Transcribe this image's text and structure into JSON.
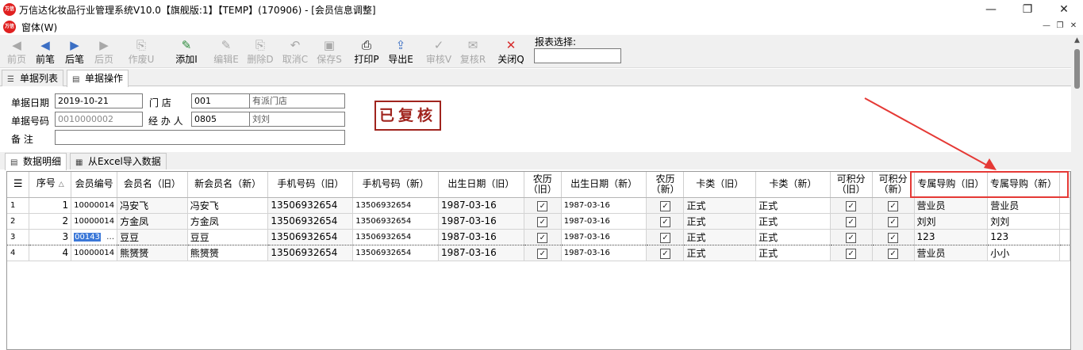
{
  "window": {
    "title": "万信达化妆品行业管理系统V10.0【旗舰版:1】【TEMP】(170906) - [会员信息调整]",
    "logo_text": "万信"
  },
  "menubar": {
    "menu_label": "窗体(W)"
  },
  "toolbar": {
    "buttons": [
      {
        "label": "前页",
        "icon": "◀",
        "enabled": false
      },
      {
        "label": "前笔",
        "icon": "◀",
        "enabled": true
      },
      {
        "label": "后笔",
        "icon": "▶",
        "enabled": true
      },
      {
        "label": "后页",
        "icon": "▶",
        "enabled": false
      },
      {
        "label": "作废U",
        "icon": "⎘",
        "enabled": false
      },
      {
        "label": "添加I",
        "icon": "✎",
        "enabled": true
      },
      {
        "label": "编辑E",
        "icon": "✎",
        "enabled": false
      },
      {
        "label": "删除D",
        "icon": "⎘",
        "enabled": false
      },
      {
        "label": "取消C",
        "icon": "↶",
        "enabled": false
      },
      {
        "label": "保存S",
        "icon": "▣",
        "enabled": false
      },
      {
        "label": "打印P",
        "icon": "⎙",
        "enabled": true
      },
      {
        "label": "导出E",
        "icon": "⇪",
        "enabled": true
      },
      {
        "label": "审核V",
        "icon": "✓",
        "enabled": false
      },
      {
        "label": "复核R",
        "icon": "✉",
        "enabled": false
      },
      {
        "label": "关闭Q",
        "icon": "✕",
        "enabled": true
      }
    ],
    "report_label": "报表选择:",
    "report_value": ""
  },
  "tabs_top": [
    {
      "label": "单据列表",
      "active": false
    },
    {
      "label": "单据操作",
      "active": true
    }
  ],
  "form": {
    "date_label": "单据日期",
    "date_value": "2019-10-21",
    "store_label": "门    店",
    "store_code": "001",
    "store_name": "有派门店",
    "doc_no_label": "单据号码",
    "doc_no_value": "0010000002",
    "handler_label": "经 办 人",
    "handler_code": "0805",
    "handler_name": "刘刘",
    "remark_label": "备    注",
    "remark_value": ""
  },
  "stamp": {
    "text": "已复核",
    "color": "#a0241e"
  },
  "tabs_bottom": [
    {
      "label": "数据明细",
      "active": true
    },
    {
      "label": "从Excel导入数据",
      "active": false
    }
  ],
  "grid": {
    "columns": [
      "序号",
      "会员编号",
      "会员名（旧）",
      "新会员名（新）",
      "手机号码（旧）",
      "手机号码（新）",
      "出生日期（旧）",
      "农历（旧）",
      "出生日期（新）",
      "农历（新）",
      "卡类（旧）",
      "卡类（新）",
      "可积分（旧）",
      "可积分（新）",
      "专属导购（旧）",
      "专属导购（新）"
    ],
    "sort_indicator": "△",
    "rows": [
      {
        "row_no": "1",
        "seq": "1",
        "member_no": "10000014",
        "name_old": "冯安飞",
        "name_new": "冯安飞",
        "phone_old": "13506932654",
        "phone_new": "13506932654",
        "birth_old": "1987-03-16",
        "lunar_old": true,
        "birth_new": "1987-03-16",
        "lunar_new": true,
        "card_old": "正式",
        "card_new": "正式",
        "points_old": true,
        "points_new": true,
        "guide_old": "营业员",
        "guide_new": "营业员"
      },
      {
        "row_no": "2",
        "seq": "2",
        "member_no": "10000014",
        "name_old": "方金凤",
        "name_new": "方金凤",
        "phone_old": "13506932654",
        "phone_new": "13506932654",
        "birth_old": "1987-03-16",
        "lunar_old": true,
        "birth_new": "1987-03-16",
        "lunar_new": true,
        "card_old": "正式",
        "card_new": "正式",
        "points_old": true,
        "points_new": true,
        "guide_old": "刘刘",
        "guide_new": "刘刘"
      },
      {
        "row_no": "3",
        "seq": "3",
        "member_no": "00143",
        "name_old": "豆豆",
        "name_new": "豆豆",
        "phone_old": "13506932654",
        "phone_new": "13506932654",
        "birth_old": "1987-03-16",
        "lunar_old": true,
        "birth_new": "1987-03-16",
        "lunar_new": true,
        "card_old": "正式",
        "card_new": "正式",
        "points_old": true,
        "points_new": true,
        "guide_old": "123",
        "guide_new": "123"
      },
      {
        "row_no": "4",
        "seq": "4",
        "member_no": "10000014",
        "name_old": "熊赟赟",
        "name_new": "熊赟赟",
        "phone_old": "13506932654",
        "phone_new": "13506932654",
        "birth_old": "1987-03-16",
        "lunar_old": true,
        "birth_new": "1987-03-16",
        "lunar_new": true,
        "card_old": "正式",
        "card_new": "正式",
        "points_old": true,
        "points_new": true,
        "guide_old": "营业员",
        "guide_new": "小小"
      }
    ],
    "selected_row": 3
  },
  "annotation": {
    "color": "#e53935"
  }
}
